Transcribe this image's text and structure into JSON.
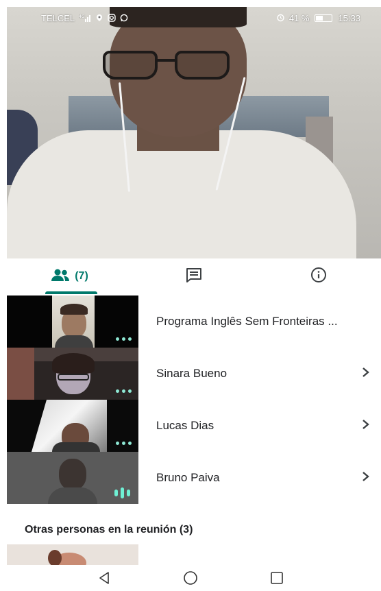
{
  "status_bar": {
    "carrier": "TELCEL",
    "network": "4G",
    "battery_percent": "41 %",
    "time": "15:33"
  },
  "tabs": [
    {
      "icon": "people-icon",
      "count": "(7)",
      "active": true
    },
    {
      "icon": "chat-icon"
    },
    {
      "icon": "info-icon"
    }
  ],
  "participants": [
    {
      "name": "Programa Inglês Sem Fronteiras ...",
      "indicator": "dots"
    },
    {
      "name": "Sinara Bueno",
      "indicator": "dots"
    },
    {
      "name": "Lucas Dias",
      "indicator": "dots"
    },
    {
      "name": "Bruno Paiva",
      "indicator": "speaking"
    }
  ],
  "others_section": {
    "title": "Otras personas en la reunión (3)"
  },
  "nav": {
    "back": "back-icon",
    "home": "home-icon",
    "recents": "recents-icon"
  },
  "colors": {
    "accent": "#00796b",
    "indicator": "#8ee8d4"
  }
}
